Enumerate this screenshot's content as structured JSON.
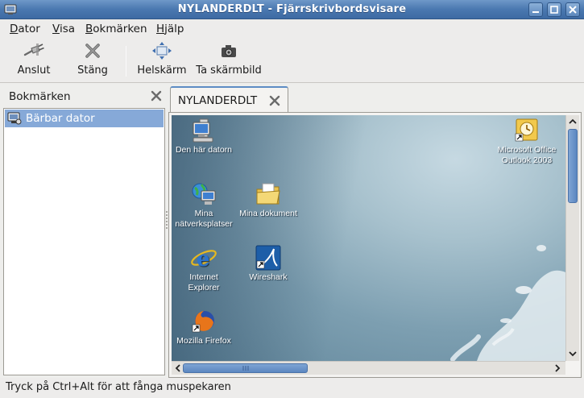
{
  "window": {
    "title": "NYLANDERDLT - Fjärrskrivbordsvisare",
    "colors": {
      "titlebar": "#4a78b0",
      "selection": "#86a9d8"
    }
  },
  "menu": {
    "items": [
      {
        "label": "Dator",
        "mnemonic": "D",
        "rest": "ator"
      },
      {
        "label": "Visa",
        "mnemonic": "V",
        "rest": "isa"
      },
      {
        "label": "Bokmärken",
        "mnemonic": "B",
        "rest": "okmärken"
      },
      {
        "label": "Hjälp",
        "mnemonic": "H",
        "rest": "jälp"
      }
    ]
  },
  "toolbar": {
    "connect": {
      "label": "Anslut",
      "icon": "plug-icon"
    },
    "close": {
      "label": "Stäng",
      "icon": "close-x-icon"
    },
    "fullscreen": {
      "label": "Helskärm",
      "icon": "fullscreen-arrows-icon"
    },
    "screenshot": {
      "label": "Ta skärmbild",
      "icon": "camera-icon"
    }
  },
  "sidebar": {
    "title": "Bokmärken",
    "items": [
      {
        "label": "Bärbar dator",
        "icon": "remote-desktop-icon",
        "selected": true
      }
    ]
  },
  "tabs": [
    {
      "label": "NYLANDERDLT",
      "icon": "tab-close-icon"
    }
  ],
  "desktop": {
    "icons": [
      {
        "label_lines": [
          "Den här datorn"
        ],
        "icon": "my-computer-icon"
      },
      {
        "label_lines": [
          "Mina",
          "nätverksplatser"
        ],
        "icon": "network-places-icon"
      },
      {
        "label_lines": [
          "Mina dokument"
        ],
        "icon": "my-documents-icon"
      },
      {
        "label_lines": [
          "Internet",
          "Explorer"
        ],
        "icon": "internet-explorer-icon"
      },
      {
        "label_lines": [
          "Wireshark"
        ],
        "icon": "wireshark-icon"
      },
      {
        "label_lines": [
          "Mozilla Firefox"
        ],
        "icon": "firefox-icon"
      },
      {
        "label_lines": [
          "Microsoft Office",
          "Outlook 2003"
        ],
        "icon": "outlook-icon"
      }
    ]
  },
  "status": {
    "text": "Tryck på Ctrl+Alt för att fånga muspekaren"
  }
}
